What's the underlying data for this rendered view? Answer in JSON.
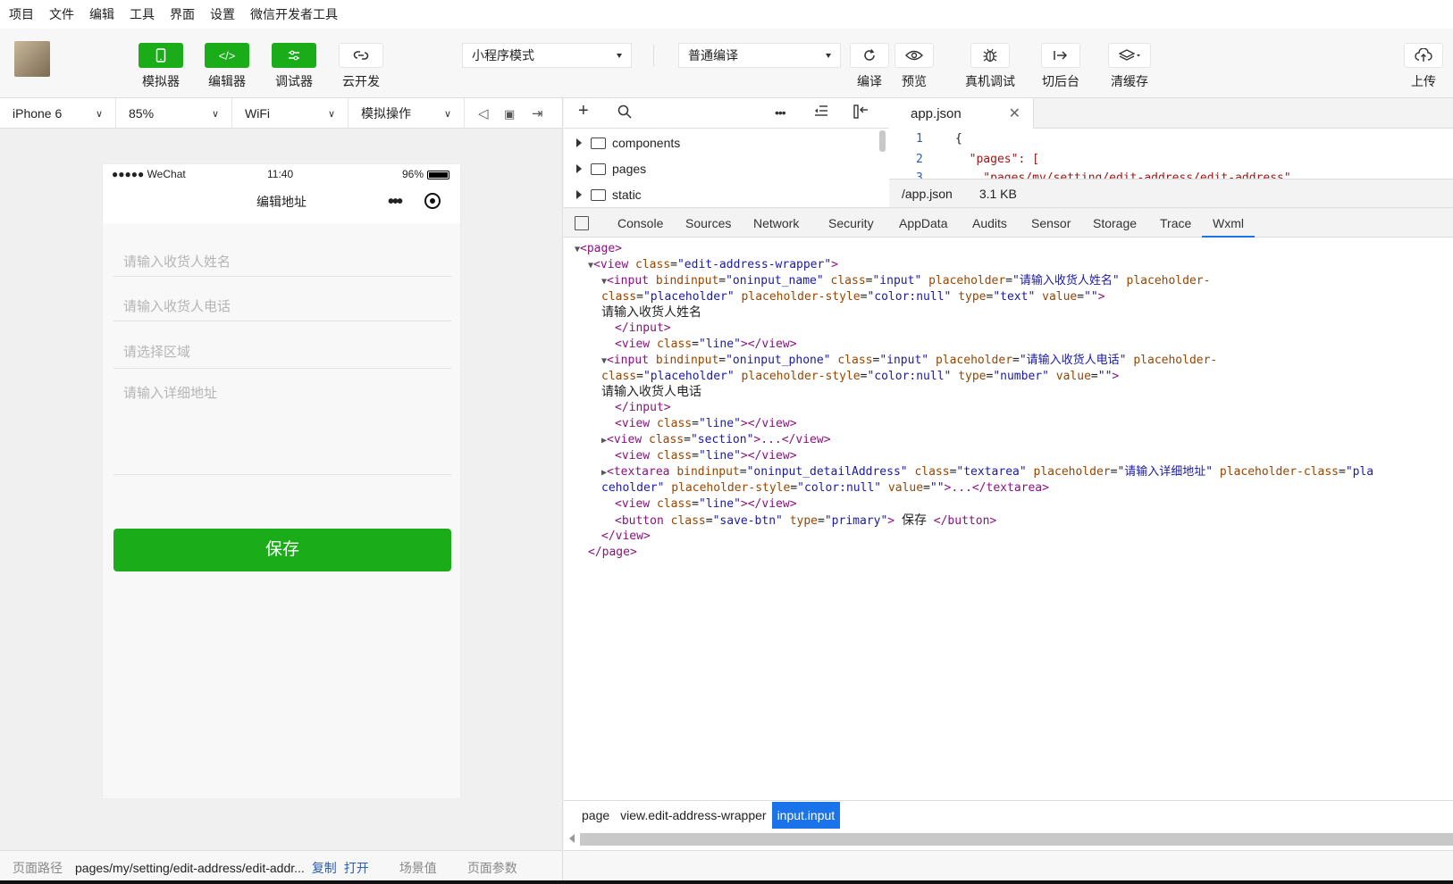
{
  "menubar": [
    "项目",
    "文件",
    "编辑",
    "工具",
    "界面",
    "设置",
    "微信开发者工具"
  ],
  "toolbar": {
    "simulator": "模拟器",
    "editor": "编辑器",
    "debugger": "调试器",
    "cloud": "云开发",
    "mode": "小程序模式",
    "compile_mode": "普通编译",
    "compile": "编译",
    "preview": "预览",
    "remote_debug": "真机调试",
    "background": "切后台",
    "clear_cache": "清缓存",
    "upload": "上传"
  },
  "devbar": {
    "device": "iPhone 6",
    "zoom": "85%",
    "network": "WiFi",
    "operation": "模拟操作"
  },
  "phone": {
    "carrier": "●●●●● WeChat",
    "time": "11:40",
    "battery": "96%",
    "title": "编辑地址",
    "name_placeholder": "请输入收货人姓名",
    "phone_placeholder": "请输入收货人电话",
    "region_placeholder": "请选择区域",
    "detail_placeholder": "请输入详细地址",
    "save": "保存"
  },
  "bottombar": {
    "path_label": "页面路径",
    "path": "pages/my/setting/edit-address/edit-addr...",
    "copy": "复制",
    "open": "打开",
    "scene": "场景值",
    "params": "页面参数"
  },
  "filetree": [
    "components",
    "pages",
    "static"
  ],
  "editor": {
    "tab": "app.json",
    "lines": [
      {
        "n": "1",
        "code": "{"
      },
      {
        "n": "2",
        "code": "  \"pages\": ["
      },
      {
        "n": "3",
        "code": "    \"pages/my/setting/edit-address/edit-address\","
      }
    ],
    "file": "/app.json",
    "size": "3.1 KB"
  },
  "devtools_tabs": [
    "Console",
    "Sources",
    "Network",
    "Security",
    "AppData",
    "Audits",
    "Sensor",
    "Storage",
    "Trace",
    "Wxml"
  ],
  "wxml": {
    "l1": "<page>",
    "l2a": "<view",
    "l2b": "class",
    "l2c": "\"edit-address-wrapper\"",
    "l2d": ">",
    "input1_tag": "<input",
    "input1_attrs_a": "bindinput",
    "input1_val_a": "\"oninput_name\"",
    "class_attr": "class",
    "input_val": "\"input\"",
    "placeholder_attr": "placeholder",
    "ph1": "\"请输入收货人姓名\"",
    "phc_tail": "placeholder-",
    "phc_head": "class",
    "phc_val": "\"placeholder\"",
    "phs_attr": "placeholder-style",
    "phs_val": "\"color:null\"",
    "type_attr": "type",
    "type_text": "\"text\"",
    "value_attr": "value",
    "value_val": "\"\"",
    "text1": "请输入收货人姓名",
    "close_input": "</input>",
    "line_view_open": "<view",
    "line_val": "\"line\"",
    "line_view_close": "></view>",
    "input2_val_a": "\"oninput_phone\"",
    "ph2": "\"请输入收货人电话\"",
    "type_number": "\"number\"",
    "text2": "请输入收货人电话",
    "section_val": "\"section\"",
    "collapsed": ">...</view>",
    "textarea_tag": "<textarea",
    "ta_bind": "\"oninput_detailAddress\"",
    "ta_class": "\"textarea\"",
    "ph3": "\"请输入详细地址\"",
    "phc_class_tail": "placeholder-class",
    "phc_pla": "\"pla",
    "phc_rest": "ceholder\"",
    "ta_close": ">...</textarea>",
    "button_tag": "<button",
    "btn_class": "\"save-btn\"",
    "btn_type": "\"primary\"",
    "btn_text": "保存",
    "btn_close": "</button>",
    "view_close": "</view>",
    "page_close": "</page>"
  },
  "crumbs": [
    "page",
    "view.edit-address-wrapper",
    "input.input"
  ]
}
